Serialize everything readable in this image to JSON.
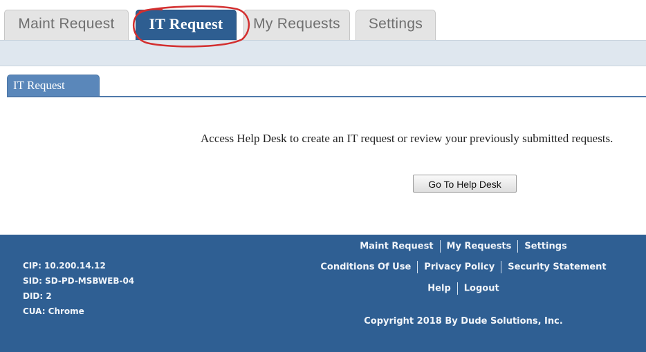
{
  "tabs": [
    {
      "label": "Maint Request"
    },
    {
      "label": "IT Request"
    },
    {
      "label": "My Requests"
    },
    {
      "label": "Settings"
    }
  ],
  "panel": {
    "tab_label": "IT Request",
    "message": "Access Help Desk to create an IT request or review your previously submitted requests.",
    "button_label": "Go To Help Desk"
  },
  "footer": {
    "info": {
      "cip": "CIP: 10.200.14.12",
      "sid": "SID: SD-PD-MSBWEB-04",
      "did": "DID: 2",
      "cua": "CUA: Chrome"
    },
    "links": {
      "maint_request": "Maint Request",
      "my_requests": "My Requests",
      "settings": "Settings",
      "conditions": "Conditions Of Use",
      "privacy": "Privacy Policy",
      "security": "Security Statement",
      "help": "Help",
      "logout": "Logout"
    },
    "copyright": "Copyright 2018 By Dude Solutions, Inc."
  },
  "colors": {
    "primary_blue": "#2e5e91",
    "panel_tab_blue": "#5a87ba",
    "annotation_red": "#d32f2f"
  }
}
